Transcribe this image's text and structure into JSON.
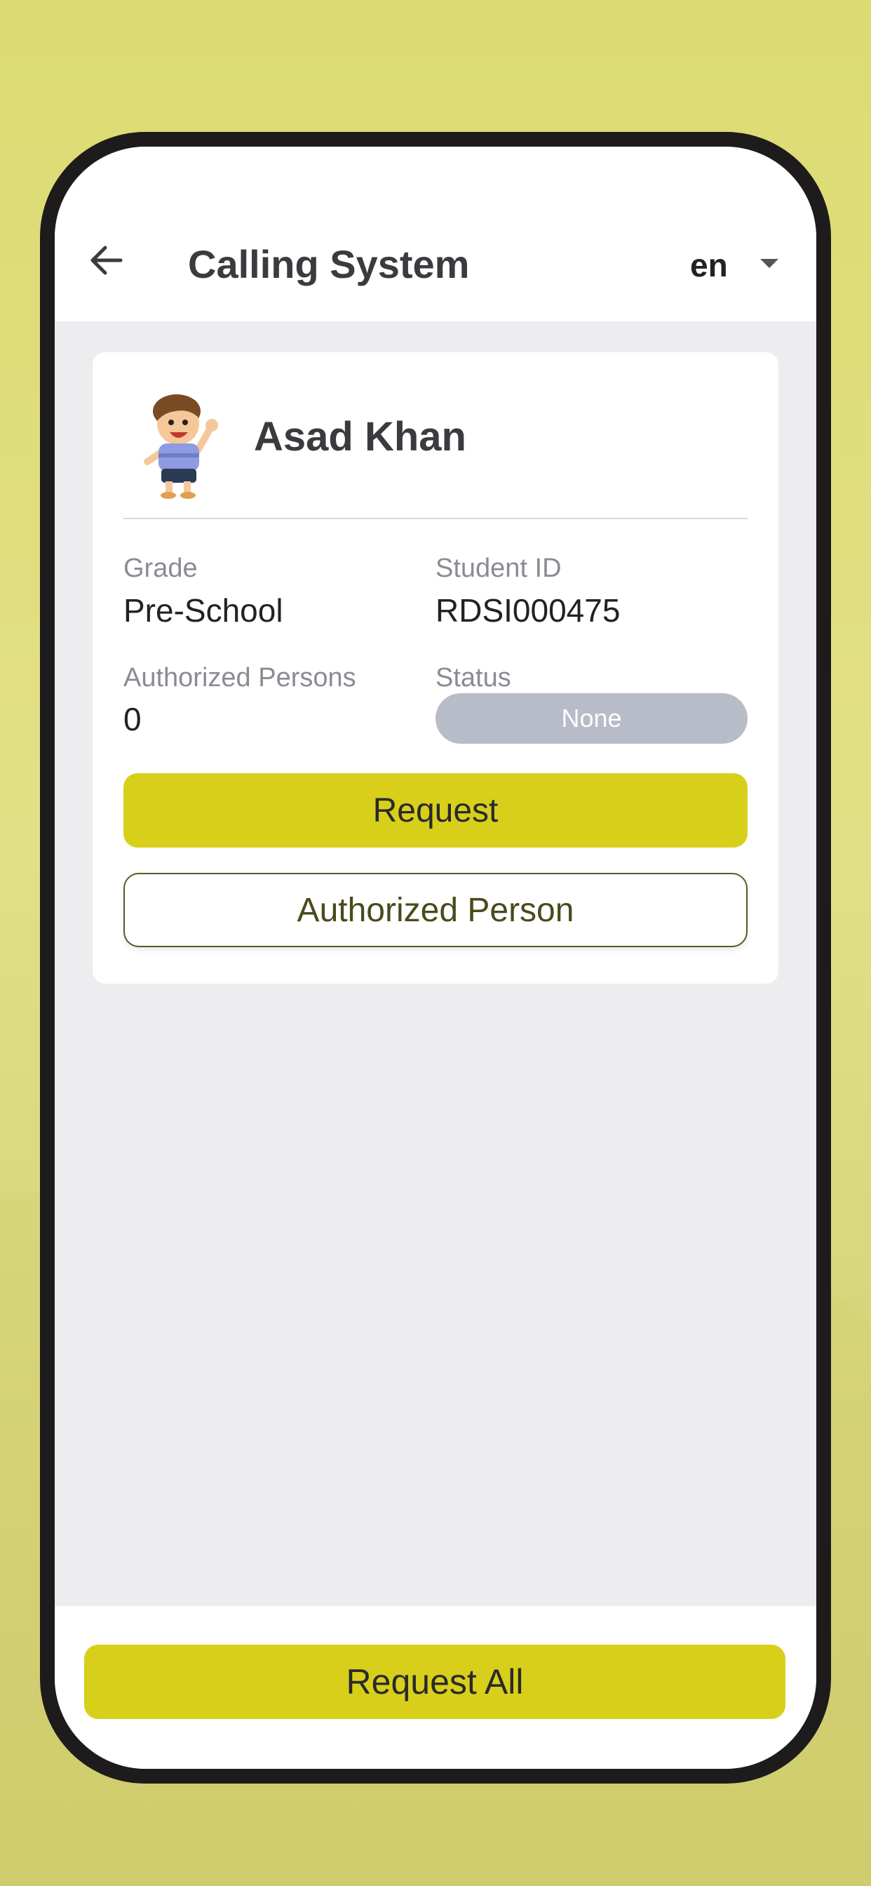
{
  "header": {
    "title": "Calling System",
    "language": "en"
  },
  "student": {
    "name": "Asad Khan",
    "grade_label": "Grade",
    "grade_value": "Pre-School",
    "id_label": "Student ID",
    "id_value": "RDSI000475",
    "authorized_label": "Authorized Persons",
    "authorized_value": "0",
    "status_label": "Status",
    "status_value": "None"
  },
  "actions": {
    "request_label": "Request",
    "authorized_person_label": "Authorized Person",
    "request_all_label": "Request All"
  },
  "icons": {
    "back": "arrow-left-icon",
    "dropdown": "caret-down-icon",
    "avatar": "cartoon-boy-avatar"
  },
  "colors": {
    "accent": "#d8cf1b",
    "status_badge": "#b8bcc8",
    "screen_bg": "#ededf0",
    "frame": "#1d1b1c"
  }
}
